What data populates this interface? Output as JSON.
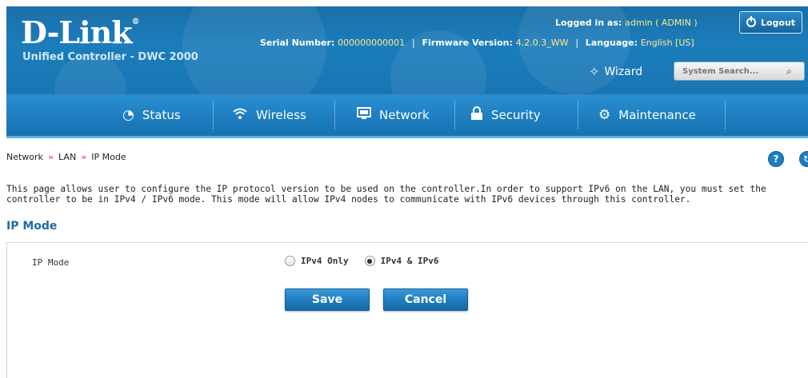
{
  "header": {
    "brand": "D-Link",
    "brand_mark": "®",
    "subtitle": "Unified Controller - DWC 2000",
    "logged_in_label": "Logged in as:",
    "logged_in_value": "admin ( ADMIN )",
    "logout_label": "Logout",
    "serial_label": "Serial Number:",
    "serial_value": "000000000001",
    "firmware_label": "Firmware Version:",
    "firmware_value": "4.2.0.3_WW",
    "language_label": "Language:",
    "language_value": "English [US]",
    "separator": "|",
    "wizard_label": "Wizard",
    "search_placeholder": "System Search..."
  },
  "nav": {
    "items": [
      {
        "label": "Status",
        "icon": "gauge-icon"
      },
      {
        "label": "Wireless",
        "icon": "wifi-icon"
      },
      {
        "label": "Network",
        "icon": "monitor-icon"
      },
      {
        "label": "Security",
        "icon": "lock-icon"
      },
      {
        "label": "Maintenance",
        "icon": "gears-icon"
      }
    ]
  },
  "breadcrumb": {
    "items": [
      "Network",
      "LAN",
      "IP Mode"
    ],
    "separator": "»"
  },
  "description": "This page allows user to configure the IP protocol version to be used on the controller.In order to support IPv6 on the LAN, you must set the controller to be in IPv4 / IPv6 mode. This mode will allow IPv4 nodes to communicate with IPv6 devices through this controller.",
  "section_title": "IP Mode",
  "form": {
    "field_label": "IP Mode",
    "options": [
      {
        "label": "IPv4 Only",
        "checked": false
      },
      {
        "label": "IPv4 & IPv6",
        "checked": true
      }
    ],
    "save_label": "Save",
    "cancel_label": "Cancel"
  },
  "colors": {
    "header_blue": "#1b7dbb",
    "nav_blue": "#1e7ec0",
    "accent_yellow": "#ffe98a",
    "section_title": "#1d6da6",
    "breadcrumb_arrow": "#e0559a"
  }
}
